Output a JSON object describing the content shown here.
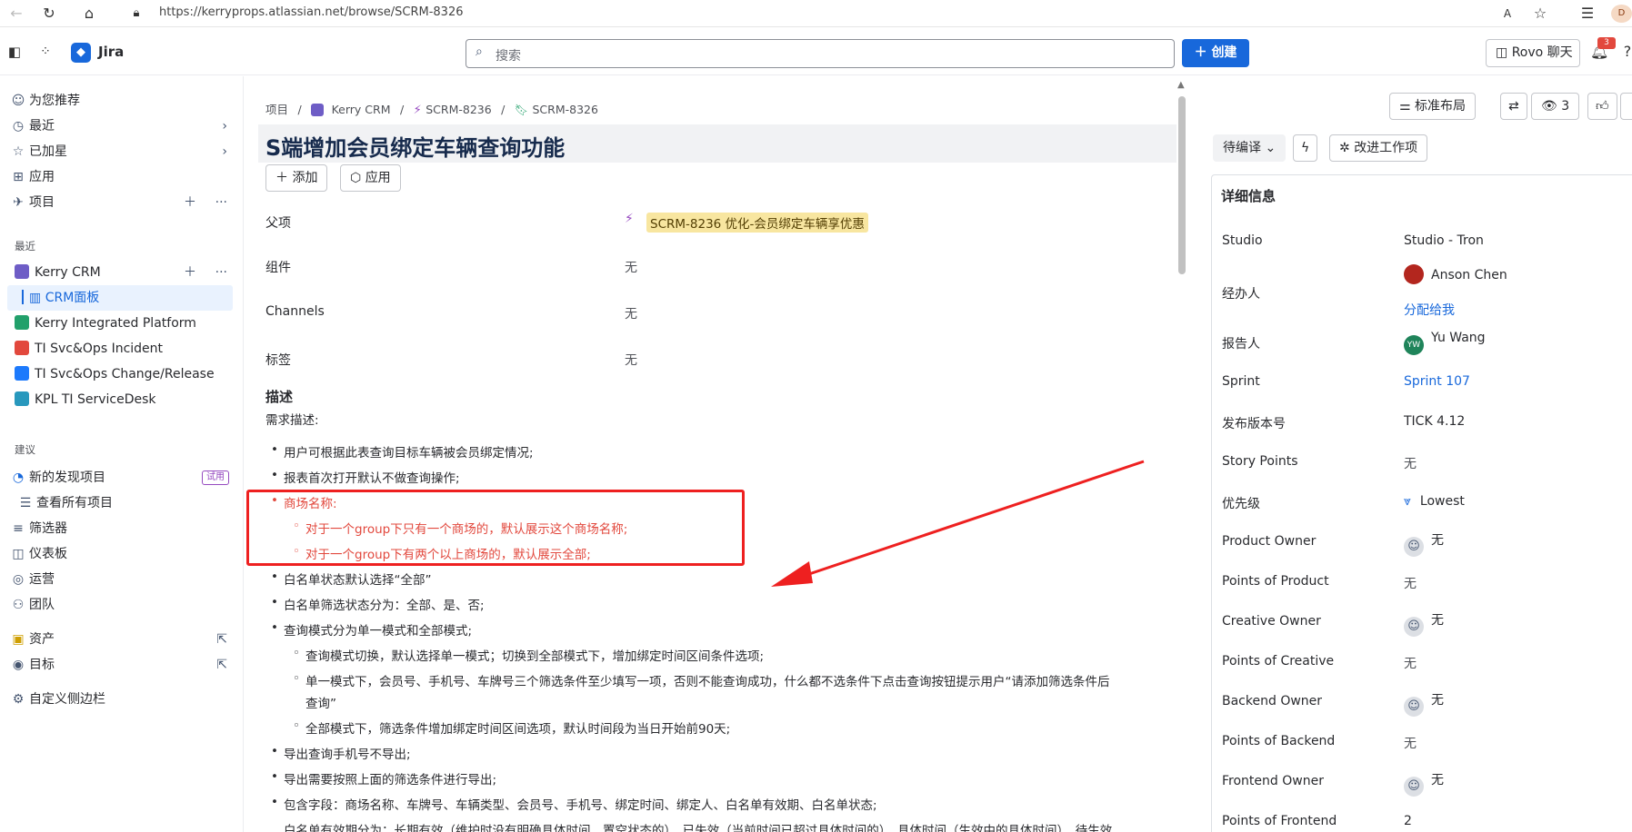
{
  "browser": {
    "url": "https://kerryprops.atlassian.net/browse/SCRM-8326",
    "profile_initials": "D"
  },
  "topbar": {
    "app_name": "Jira",
    "search_placeholder": "搜索",
    "create_label": "创建",
    "rovo_label": "Rovo 聊天",
    "notification_count": "3"
  },
  "sidebar": {
    "for_you": "为您推荐",
    "recent": "最近",
    "starred": "已加星",
    "apps": "应用",
    "projects": "项目",
    "section_recent": "最近",
    "recent_projects": [
      {
        "label": "Kerry CRM",
        "color": "#6e5dc6"
      },
      {
        "label": "Kerry Integrated Platform",
        "color": "#22a06b"
      },
      {
        "label": "TI Svc&Ops Incident",
        "color": "#e2483d"
      },
      {
        "label": "TI Svc&Ops Change/Release",
        "color": "#1d7afc"
      },
      {
        "label": "KPL TI ServiceDesk",
        "color": "#2898bd"
      }
    ],
    "crm_board": "CRM面板",
    "section_suggest": "建议",
    "new_discovery": "新的发现项目",
    "trial_badge": "试用",
    "view_all_projects": "查看所有项目",
    "filters": "筛选器",
    "dashboards": "仪表板",
    "operations": "运营",
    "teams": "团队",
    "assets": "资产",
    "goals": "目标",
    "customize": "自定义侧边栏"
  },
  "breadcrumb": {
    "projects": "项目",
    "project": "Kerry CRM",
    "parent": "SCRM-8236",
    "current": "SCRM-8326"
  },
  "issue": {
    "title": "S端增加会员绑定车辆查询功能",
    "add_label": "添加",
    "apps_label": "应用",
    "fields": {
      "parent_label": "父项",
      "parent_value": "SCRM-8236 优化-会员绑定车辆享优惠",
      "component_label": "组件",
      "component_value": "无",
      "channels_label": "Channels",
      "channels_value": "无",
      "labels_label": "标签",
      "labels_value": "无"
    },
    "description_heading": "描述",
    "description_sub": "需求描述:",
    "description_items": [
      "用户可根据此表查询目标车辆被会员绑定情况;",
      "报表首次打开默认不做查询操作;",
      "商场名称:",
      "对于一个group下只有一个商场的，默认展示这个商场名称;",
      "对于一个group下有两个以上商场的，默认展示全部;",
      "白名单状态默认选择“全部”",
      "白名单筛选状态分为：全部、是、否;",
      "查询模式分为单一模式和全部模式;",
      "查询模式切换，默认选择单一模式；切换到全部模式下，增加绑定时间区间条件选项;",
      "单一模式下，会员号、手机号、车牌号三个筛选条件至少填写一项，否则不能查询成功，什么都不选条件下点击查询按钮提示用户“请添加筛选条件后",
      "查询”",
      "全部模式下，筛选条件增加绑定时间区间选项，默认时间段为当日开始前90天;",
      "导出查询手机号不导出;",
      "导出需要按照上面的筛选条件进行导出;",
      "包含字段：商场名称、车牌号、车辆类型、会员号、手机号、绑定时间、绑定人、白名单有效期、白名单状态;",
      "白名单有效期分为：长期有效（维护时没有明确具体时间，置空状态的）、已失效（当前时间已超过具体时间的）、具体时间（生效中的具体时间）、待生效"
    ]
  },
  "right_panel": {
    "layout_label": "标准布局",
    "watch_count": "3",
    "status_label": "待编译",
    "improve_label": "改进工作项",
    "details_heading": "详细信息",
    "details": [
      {
        "label": "Studio",
        "value": "Studio - Tron"
      },
      {
        "label": "经办人",
        "value": "Anson Chen",
        "extra": "分配给我"
      },
      {
        "label": "报告人",
        "value": "Yu Wang",
        "initials": "YW"
      },
      {
        "label": "Sprint",
        "value": "Sprint 107"
      },
      {
        "label": "发布版本号",
        "value": "TICK 4.12"
      },
      {
        "label": "Story Points",
        "value": "无"
      },
      {
        "label": "优先级",
        "value": "Lowest"
      },
      {
        "label": "Product Owner",
        "value": "无"
      },
      {
        "label": "Points of Product",
        "value": "无"
      },
      {
        "label": "Creative Owner",
        "value": "无"
      },
      {
        "label": "Points of Creative",
        "value": "无"
      },
      {
        "label": "Backend Owner",
        "value": "无"
      },
      {
        "label": "Points of Backend",
        "value": "无"
      },
      {
        "label": "Frontend Owner",
        "value": "无"
      },
      {
        "label": "Points of Frontend",
        "value": "2"
      }
    ]
  },
  "colors": {
    "brand": "#1868db",
    "annotation_red": "#ee2020",
    "parent_chip": "#f8e6a0"
  }
}
